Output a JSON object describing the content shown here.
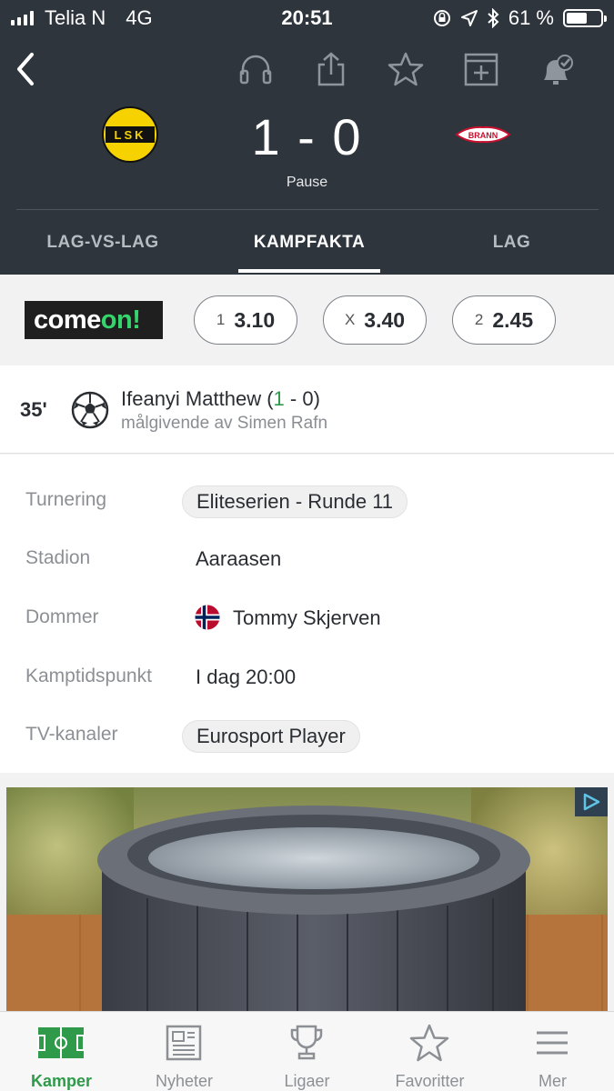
{
  "status_bar": {
    "carrier": "Telia N",
    "network": "4G",
    "time": "20:51",
    "battery": "61 %",
    "battery_level": 0.61
  },
  "toolbar": {
    "icons": [
      "back-icon",
      "headphones-icon",
      "share-icon",
      "star-icon",
      "add-calendar-icon",
      "bell-check-icon"
    ]
  },
  "match": {
    "home_team_logo": "LSK",
    "away_team_logo": "BRANN",
    "score": "1 - 0",
    "status": "Pause"
  },
  "tabs": [
    {
      "label": "LAG-VS-LAG",
      "active": false
    },
    {
      "label": "KAMPFAKTA",
      "active": true
    },
    {
      "label": "LAG",
      "active": false
    }
  ],
  "odds": {
    "brand_left": "come",
    "brand_right": "on!",
    "items": [
      {
        "label": "1",
        "value": "3.10"
      },
      {
        "label": "X",
        "value": "3.40"
      },
      {
        "label": "2",
        "value": "2.45"
      }
    ]
  },
  "event": {
    "minute": "35'",
    "player": "Ifeanyi Matthew",
    "score_open": " (",
    "score_home": "1",
    "score_rest": " - 0)",
    "assist": "målgivende av Simen Rafn"
  },
  "facts": {
    "tournament_label": "Turnering",
    "tournament_value": "Eliteserien - Runde 11",
    "stadium_label": "Stadion",
    "stadium_value": "Aaraasen",
    "referee_label": "Dommer",
    "referee_value": "Tommy Skjerven",
    "kickoff_label": "Kamptidspunkt",
    "kickoff_value": "I dag 20:00",
    "tv_label": "TV-kanaler",
    "tv_value": "Eurosport Player"
  },
  "bottom_nav": [
    {
      "label": "Kamper",
      "icon": "pitch-icon",
      "active": true
    },
    {
      "label": "Nyheter",
      "icon": "news-icon",
      "active": false
    },
    {
      "label": "Ligaer",
      "icon": "trophy-icon",
      "active": false
    },
    {
      "label": "Favoritter",
      "icon": "star-icon",
      "active": false
    },
    {
      "label": "Mer",
      "icon": "menu-icon",
      "active": false
    }
  ],
  "colors": {
    "header_bg": "#2e353d",
    "accent_green": "#2e9a4a"
  }
}
